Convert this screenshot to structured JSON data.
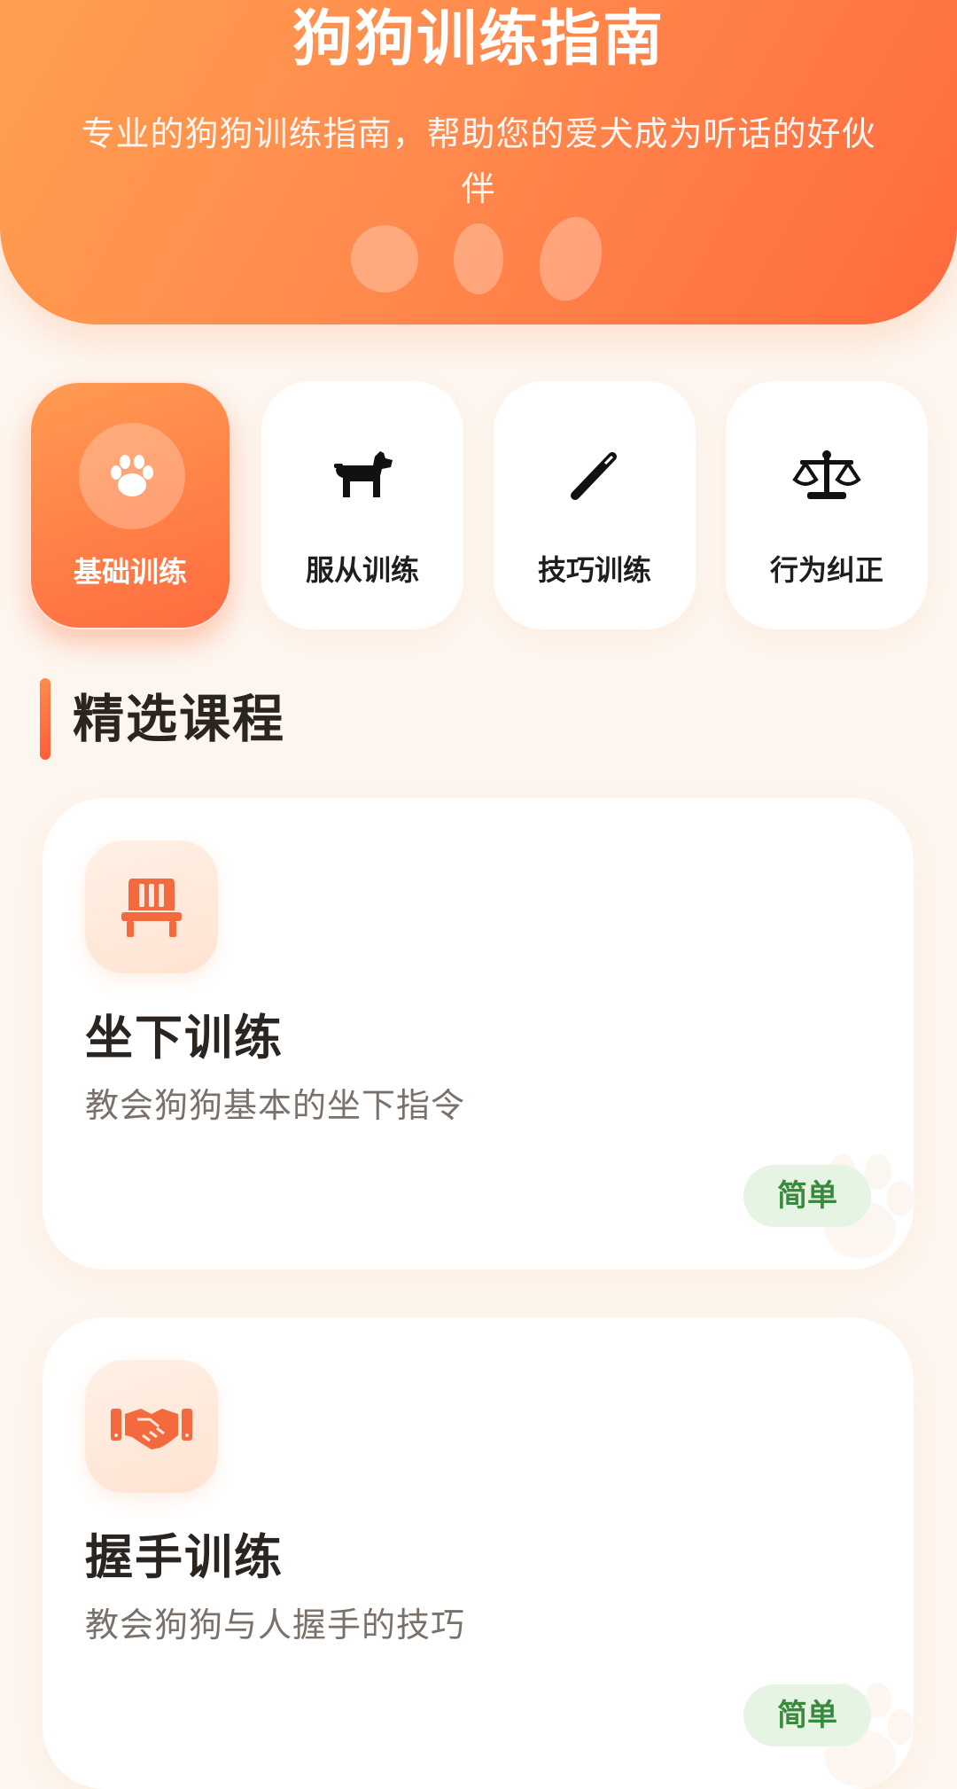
{
  "hero": {
    "title": "狗狗训练指南",
    "subtitle": "专业的狗狗训练指南，帮助您的爱犬成为听话的好伙伴"
  },
  "categories": [
    {
      "label": "基础训练",
      "icon": "paw-icon",
      "active": true
    },
    {
      "label": "服从训练",
      "icon": "dog-icon",
      "active": false
    },
    {
      "label": "技巧训练",
      "icon": "wand-icon",
      "active": false
    },
    {
      "label": "行为纠正",
      "icon": "scale-icon",
      "active": false
    }
  ],
  "section": {
    "title": "精选课程"
  },
  "courses": [
    {
      "title": "坐下训练",
      "description": "教会狗狗基本的坐下指令",
      "badge": "简单",
      "icon": "chair-icon"
    },
    {
      "title": "握手训练",
      "description": "教会狗狗与人握手的技巧",
      "badge": "简单",
      "icon": "handshake-icon"
    }
  ],
  "colors": {
    "accent": "#ff7a45",
    "background": "#fdf6ef",
    "badge_bg": "#e5f4e3",
    "badge_text": "#3a8a3e"
  }
}
